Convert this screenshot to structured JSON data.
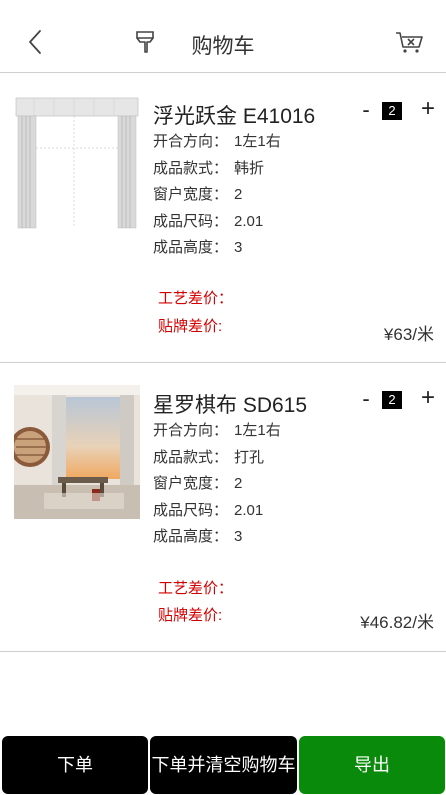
{
  "header": {
    "title": "购物车",
    "back_icon": "chevron-left-icon",
    "brush_icon": "paint-brush-icon",
    "clear_icon": "cart-clear-icon"
  },
  "items": [
    {
      "name": "浮光跃金 E41016",
      "quantity": "2",
      "minus": "-",
      "plus": "+",
      "attrs": [
        {
          "label": "开合方向：",
          "value": "1左1右"
        },
        {
          "label": "成品款式：",
          "value": "韩折"
        },
        {
          "label": "窗户宽度：",
          "value": "2"
        },
        {
          "label": "成品尺码：",
          "value": "2.01"
        },
        {
          "label": "成品高度：",
          "value": "3"
        }
      ],
      "craft_diff_label": "工艺差价：",
      "brand_diff_label": "贴牌差价:",
      "price": "¥63/米"
    },
    {
      "name": "星罗棋布 SD615",
      "quantity": "2",
      "minus": "-",
      "plus": "+",
      "attrs": [
        {
          "label": "开合方向：",
          "value": "1左1右"
        },
        {
          "label": "成品款式：",
          "value": "打孔"
        },
        {
          "label": "窗户宽度：",
          "value": "2"
        },
        {
          "label": "成品尺码：",
          "value": "2.01"
        },
        {
          "label": "成品高度：",
          "value": "3"
        }
      ],
      "craft_diff_label": "工艺差价：",
      "brand_diff_label": "贴牌差价:",
      "price": "¥46.82/米"
    }
  ],
  "footer": {
    "order_label": "下单",
    "order_clear_label": "下单并清空购物车",
    "export_label": "导出",
    "export_color": "#0a8a0a"
  }
}
